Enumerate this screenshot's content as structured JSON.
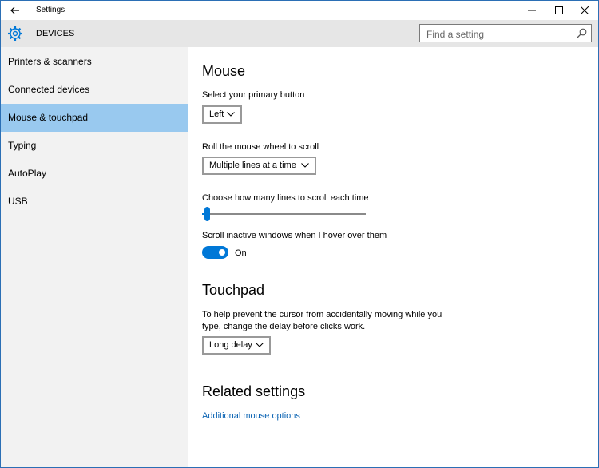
{
  "window": {
    "title": "Settings"
  },
  "header": {
    "title": "DEVICES",
    "search_placeholder": "Find a setting"
  },
  "sidebar": {
    "items": [
      {
        "label": "Printers & scanners",
        "active": false
      },
      {
        "label": "Connected devices",
        "active": false
      },
      {
        "label": "Mouse & touchpad",
        "active": true
      },
      {
        "label": "Typing",
        "active": false
      },
      {
        "label": "AutoPlay",
        "active": false
      },
      {
        "label": "USB",
        "active": false
      }
    ]
  },
  "mouse": {
    "heading": "Mouse",
    "primary_button_label": "Select your primary button",
    "primary_button_value": "Left",
    "scroll_mode_label": "Roll the mouse wheel to scroll",
    "scroll_mode_value": "Multiple lines at a time",
    "lines_label": "Choose how many lines to scroll each time",
    "lines_slider_fraction": 0.03,
    "inactive_scroll_label": "Scroll inactive windows when I hover over them",
    "inactive_scroll_state": "On"
  },
  "touchpad": {
    "heading": "Touchpad",
    "delay_description_line1": "To help prevent the cursor from accidentally moving while you",
    "delay_description_line2": "type, change the delay before clicks work.",
    "delay_value": "Long delay"
  },
  "related": {
    "heading": "Related settings",
    "link": "Additional mouse options"
  },
  "colors": {
    "accent": "#0078d7",
    "selected_nav": "#99c9ef",
    "link": "#0a63b3"
  }
}
